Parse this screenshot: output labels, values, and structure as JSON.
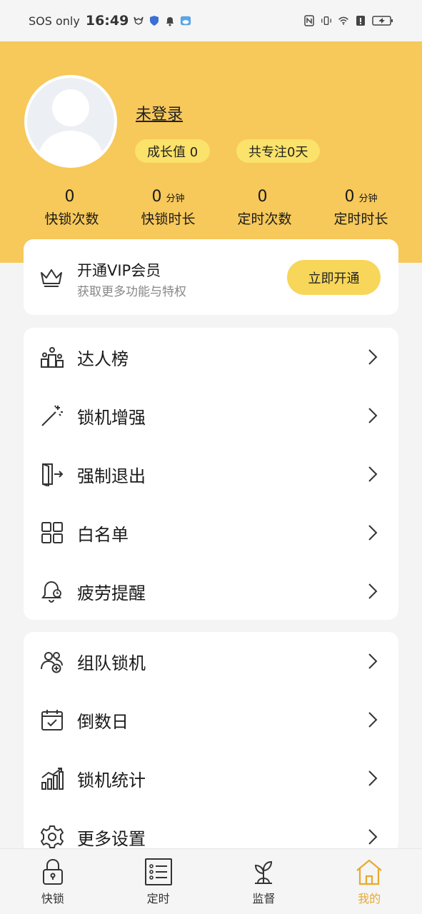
{
  "status_bar": {
    "carrier": "SOS only",
    "time": "16:49"
  },
  "profile": {
    "username": "未登录",
    "growth": "成长值 0",
    "focus": "共专注0天"
  },
  "stats": [
    {
      "value": "0",
      "unit": "",
      "label": "快锁次数"
    },
    {
      "value": "0",
      "unit": "分钟",
      "label": "快锁时长"
    },
    {
      "value": "0",
      "unit": "",
      "label": "定时次数"
    },
    {
      "value": "0",
      "unit": "分钟",
      "label": "定时时长"
    }
  ],
  "vip": {
    "title": "开通VIP会员",
    "subtitle": "获取更多功能与特权",
    "button": "立即开通"
  },
  "menu1": [
    {
      "label": "达人榜",
      "icon": "podium-icon"
    },
    {
      "label": "锁机增强",
      "icon": "magic-wand-icon"
    },
    {
      "label": "强制退出",
      "icon": "exit-door-icon"
    },
    {
      "label": "白名单",
      "icon": "grid-icon"
    },
    {
      "label": "疲劳提醒",
      "icon": "bell-icon"
    }
  ],
  "menu2": [
    {
      "label": "组队锁机",
      "icon": "team-icon"
    },
    {
      "label": "倒数日",
      "icon": "calendar-icon"
    },
    {
      "label": "锁机统计",
      "icon": "stats-icon"
    },
    {
      "label": "更多设置",
      "icon": "gear-icon"
    }
  ],
  "nav": [
    {
      "label": "快锁",
      "icon": "lock-icon"
    },
    {
      "label": "定时",
      "icon": "list-icon"
    },
    {
      "label": "监督",
      "icon": "sprout-icon"
    },
    {
      "label": "我的",
      "icon": "home-icon"
    }
  ],
  "colors": {
    "header": "#f7c85a",
    "pill": "#fbe26a",
    "vip_button": "#f7d659",
    "active_nav": "#e8a92e"
  }
}
